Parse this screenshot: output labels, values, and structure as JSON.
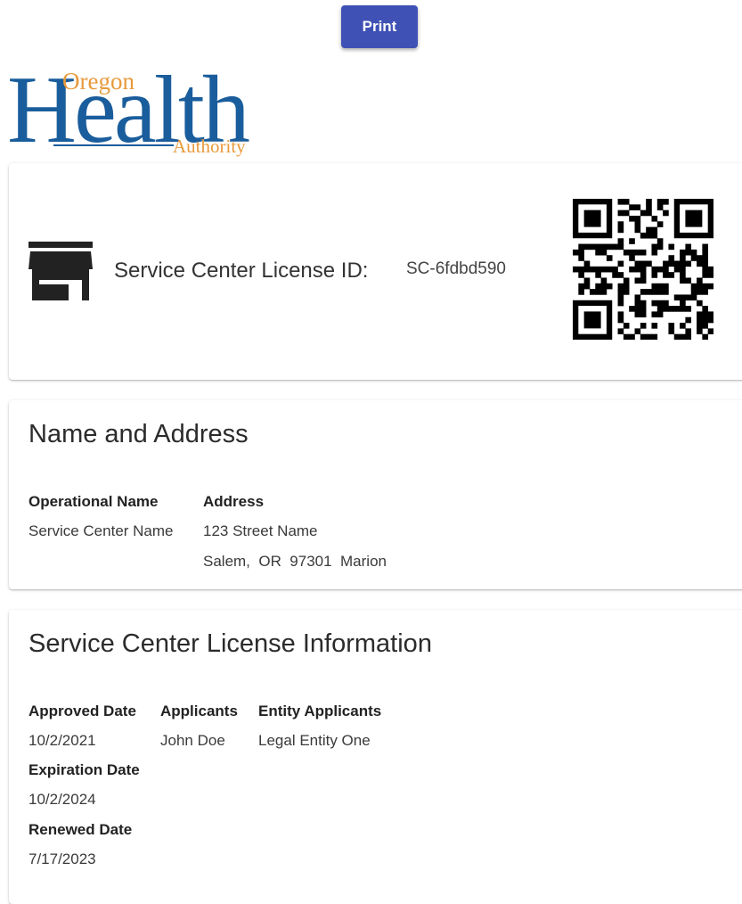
{
  "toolbar": {
    "print_label": "Print"
  },
  "logo": {
    "line1": "Oregon",
    "line2": "Health",
    "line3": "Authority"
  },
  "license_card": {
    "label": "Service Center License ID:",
    "id": "SC-6fdbd590",
    "icon": "store-icon",
    "qr_icon": "qr-code-icon"
  },
  "address_card": {
    "title": "Name and Address",
    "operational_name_label": "Operational Name",
    "operational_name": "Service Center Name",
    "address_label": "Address",
    "address_line1": "123 Street Name",
    "address_line2": "Salem,  OR  97301  Marion"
  },
  "info_card": {
    "title": "Service Center License Information",
    "approved_label": "Approved Date",
    "approved_value": "10/2/2021",
    "expiration_label": "Expiration Date",
    "expiration_value": "10/2/2024",
    "renewed_label": "Renewed Date",
    "renewed_value": "7/17/2023",
    "applicants_label": "Applicants",
    "applicants_value": "John Doe",
    "entity_label": "Entity Applicants",
    "entity_value": "Legal Entity One"
  },
  "colors": {
    "primary": "#3f51b5",
    "logo_blue": "#1a5d9c",
    "logo_orange": "#e89a3c"
  }
}
